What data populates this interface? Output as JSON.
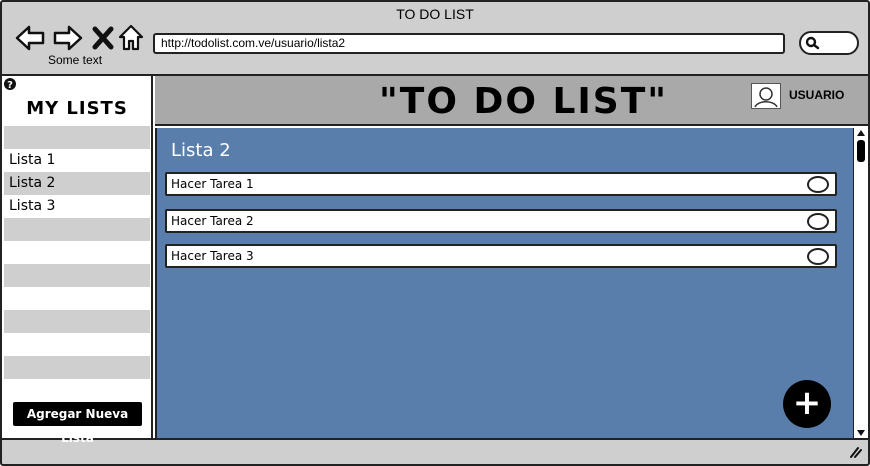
{
  "window": {
    "title": "TO DO LIST",
    "some_text": "Some text",
    "url": "http://todolist.com.ve/usuario/lista2"
  },
  "nav_icons": [
    "back-arrow-icon",
    "forward-arrow-icon",
    "close-icon",
    "home-icon",
    "search-icon"
  ],
  "sidebar": {
    "help_icon": "help-icon",
    "title": "MY LISTS",
    "items": [
      {
        "label": "Lista 1"
      },
      {
        "label": "Lista 2"
      },
      {
        "label": "Lista 3"
      }
    ],
    "add_button_label": "Agregar Nueva Lista"
  },
  "header": {
    "title": "\"TO DO LIST\"",
    "user_label": "USUARIO",
    "user_icon": "user-avatar-icon"
  },
  "main": {
    "list_title": "Lista 2",
    "tasks": [
      {
        "label": "Hacer Tarea 1",
        "done": false
      },
      {
        "label": "Hacer Tarea 2",
        "done": false
      },
      {
        "label": "Hacer Tarea 3",
        "done": false
      }
    ],
    "fab_symbol": "+"
  },
  "colors": {
    "panel": "#5a7eab",
    "header": "#a9a9a9",
    "chrome": "#cfcfcf"
  }
}
